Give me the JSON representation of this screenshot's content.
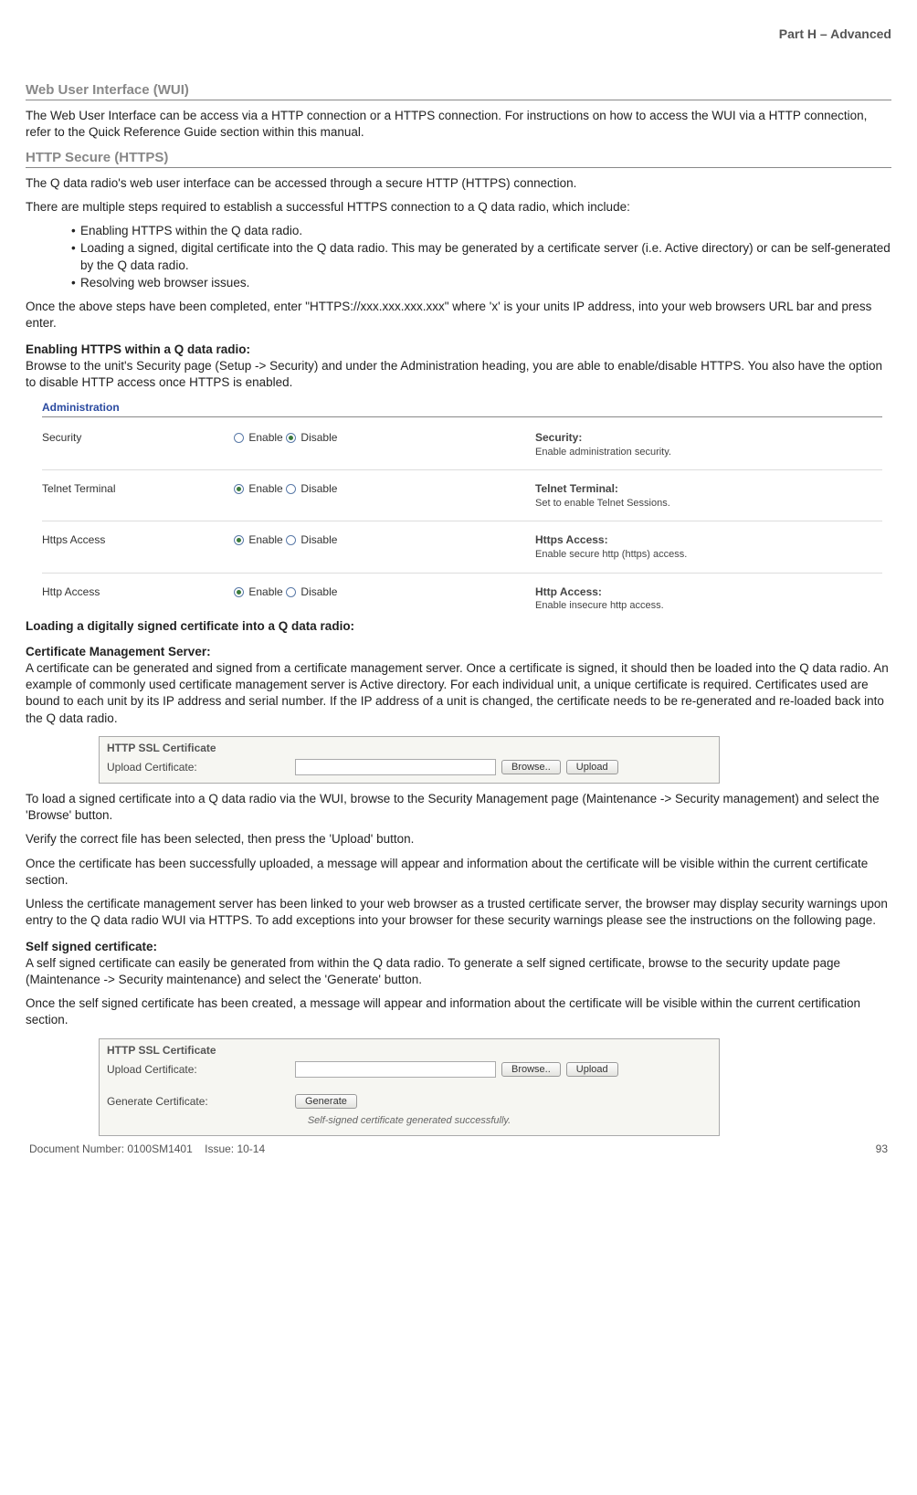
{
  "header": {
    "part": "Part H – Advanced"
  },
  "sec1": {
    "title": "Web User Interface (WUI)",
    "p1": "The Web User Interface can be access via a HTTP connection or a HTTPS connection. For instructions on how to access the WUI via a HTTP connection, refer to the Quick Reference Guide section within this manual."
  },
  "sec2": {
    "title": "HTTP Secure (HTTPS)",
    "p1": "The Q data radio's web user interface can be accessed through a secure HTTP (HTTPS) connection.",
    "p2": "There are multiple steps required to establish a successful HTTPS connection to a Q data radio, which include:",
    "b1": "Enabling HTTPS within the Q data radio.",
    "b2": "Loading a signed, digital certificate into the Q data radio. This may be generated by a certificate server (i.e. Active directory) or can be self-generated by the Q data radio.",
    "b3": "Resolving web browser issues.",
    "p3": "Once the above steps have been completed, enter \"HTTPS://xxx.xxx.xxx.xxx\" where 'x' is your units IP address, into your web browsers URL bar and press enter."
  },
  "enable": {
    "h": "Enabling HTTPS within a Q data radio:",
    "p": "Browse to the unit's Security page (Setup -> Security) and under the Administration heading, you are able to enable/disable HTTPS. You also have the option to disable HTTP access once HTTPS is enabled."
  },
  "admin": {
    "title": "Administration",
    "enable": "Enable",
    "disable": "Disable",
    "rows": [
      {
        "label": "Security",
        "sel": "disable",
        "dtitle": "Security:",
        "dtext": "Enable administration security."
      },
      {
        "label": "Telnet Terminal",
        "sel": "enable",
        "dtitle": "Telnet Terminal:",
        "dtext": "Set to enable Telnet Sessions."
      },
      {
        "label": "Https Access",
        "sel": "enable",
        "dtitle": "Https Access:",
        "dtext": "Enable secure http (https) access."
      },
      {
        "label": "Http Access",
        "sel": "enable",
        "dtitle": "Http Access:",
        "dtext": "Enable insecure http access."
      }
    ]
  },
  "load": {
    "h": "Loading a digitally signed certificate into a Q data radio:",
    "h2": "Certificate Management Server:",
    "p1": "A certificate can be generated and signed from a certificate management server. Once a certificate is signed, it should then be loaded into the Q data radio. An example of commonly used certificate management server is Active directory. For each individual unit, a unique certificate is required. Certificates used are bound to each unit by its IP address and serial number. If the IP address of a unit is changed, the certificate needs to be re-generated and re-loaded back into the Q data radio.",
    "p2": "To load a signed certificate into a Q data radio via the WUI, browse to the Security Management page (Maintenance -> Security management) and select the 'Browse' button.",
    "p3": "Verify the correct file has been selected, then press the 'Upload' button.",
    "p4": "Once the certificate has been successfully uploaded, a message will appear and information about the certificate will be visible within the current certificate section.",
    "p5": "Unless the certificate management server has been linked to your web browser as a trusted certificate server, the browser may display security warnings upon entry to the Q data radio WUI via HTTPS. To add exceptions into your browser for these security warnings please see the instructions on the following page."
  },
  "cert1": {
    "title": "HTTP SSL Certificate",
    "label": "Upload Certificate:",
    "browse": "Browse..",
    "upload": "Upload"
  },
  "self": {
    "h": "Self signed certificate:",
    "p1": "A self signed certificate can easily be generated from within the Q data radio. To generate a self signed certificate, browse to the security update page (Maintenance -> Security maintenance) and select the 'Generate' button.",
    "p2": "Once the self signed certificate has been created, a message will appear and information about the certificate will be visible within the current certification section."
  },
  "cert2": {
    "title": "HTTP SSL Certificate",
    "label1": "Upload Certificate:",
    "label2": "Generate Certificate:",
    "browse": "Browse..",
    "upload": "Upload",
    "generate": "Generate",
    "status": "Self-signed certificate generated successfully."
  },
  "footer": {
    "doc": "Document Number: 0100SM1401",
    "issue": "Issue: 10-14",
    "page": "93"
  }
}
